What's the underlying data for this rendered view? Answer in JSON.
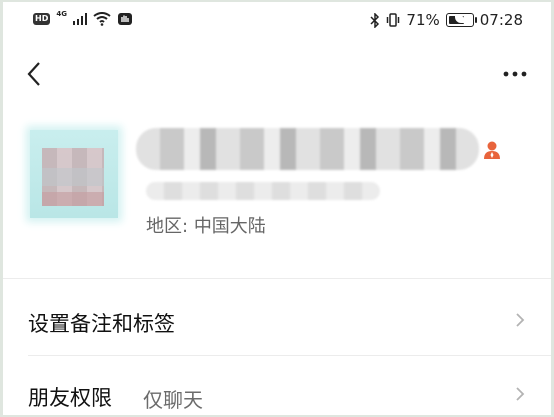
{
  "status_bar": {
    "hd": "HD",
    "network": "4G",
    "battery_percent": "71%",
    "battery_level": 0.71,
    "time": "07:28"
  },
  "nav": {
    "back_icon": "chevron-left-icon",
    "more_icon": "more-dots-icon"
  },
  "profile": {
    "region_label": "地区",
    "region_separator": ":",
    "region_value": "中国大陆",
    "person_icon_color": "#e8643c"
  },
  "rows": [
    {
      "title": "设置备注和标签",
      "value": ""
    },
    {
      "title": "朋友权限",
      "value": "仅聊天"
    }
  ]
}
